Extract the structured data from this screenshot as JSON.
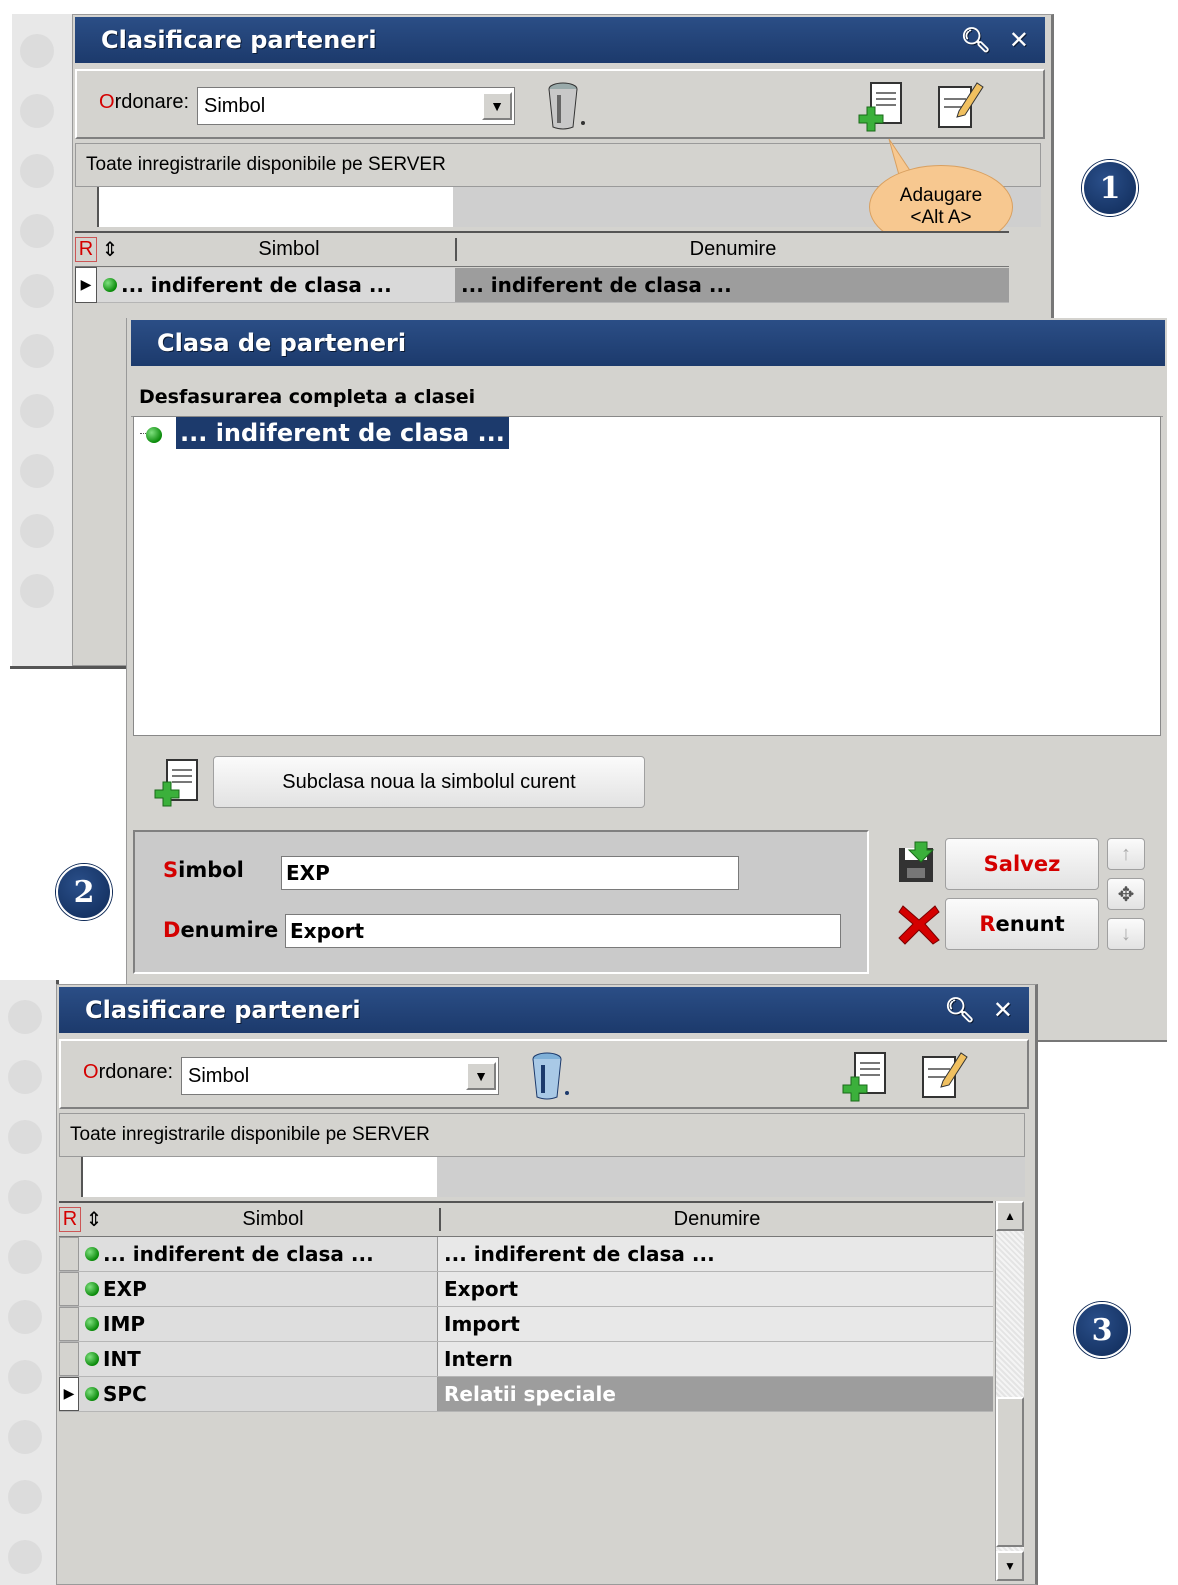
{
  "panel1": {
    "title": "Clasificare parteneri",
    "order_label_first": "O",
    "order_label_rest": "rdonare:",
    "order_value": "Simbol",
    "records_text": "Toate inregistrarile disponibile pe SERVER",
    "tooltip_line1": "Adaugare",
    "tooltip_line2": "<Alt A>",
    "col_r": "R",
    "col_sort": "⇕",
    "col_symbol": "Simbol",
    "col_name": "Denumire",
    "rows": [
      {
        "symbol": "... indiferent de clasa ...",
        "name": "... indiferent de clasa ..."
      }
    ]
  },
  "dialog": {
    "title": "Clasa de parteneri",
    "tree_header": "Desfasurarea completa a clasei",
    "tree_item": "... indiferent de clasa ...",
    "subclass_button": "Subclasa noua la simbolul curent",
    "simbol_label_first": "S",
    "simbol_label_rest": "imbol",
    "simbol_value": "EXP",
    "denumire_label_first": "D",
    "denumire_label_rest": "enumire",
    "denumire_value": "Export",
    "save_label": "Salvez",
    "cancel_label_first": "R",
    "cancel_label_rest": "enunt"
  },
  "panel3": {
    "title": "Clasificare parteneri",
    "order_label_first": "O",
    "order_label_rest": "rdonare:",
    "order_value": "Simbol",
    "records_text": "Toate inregistrarile disponibile pe SERVER",
    "col_r": "R",
    "col_sort": "⇕",
    "col_symbol": "Simbol",
    "col_name": "Denumire",
    "rows": [
      {
        "symbol": "... indiferent de clasa ...",
        "name": "... indiferent de clasa ..."
      },
      {
        "symbol": "EXP",
        "name": "Export"
      },
      {
        "symbol": "IMP",
        "name": "Import"
      },
      {
        "symbol": "INT",
        "name": "Intern"
      },
      {
        "symbol": "SPC",
        "name": "Relatii speciale"
      }
    ]
  },
  "steps": [
    "1",
    "2",
    "3"
  ],
  "colors": {
    "title_bar": "#1c3a6c",
    "panel_bg": "#d4d3cf",
    "selected_row": "#9d9d9d",
    "tooltip": "#f7c890",
    "accent_red": "#d40000"
  },
  "icons": [
    "search-icon",
    "close-icon",
    "trash-can-icon",
    "add-document-icon",
    "edit-document-icon",
    "save-icon",
    "cancel-x-icon",
    "arrow-up-icon",
    "move-icon",
    "arrow-down-icon"
  ]
}
